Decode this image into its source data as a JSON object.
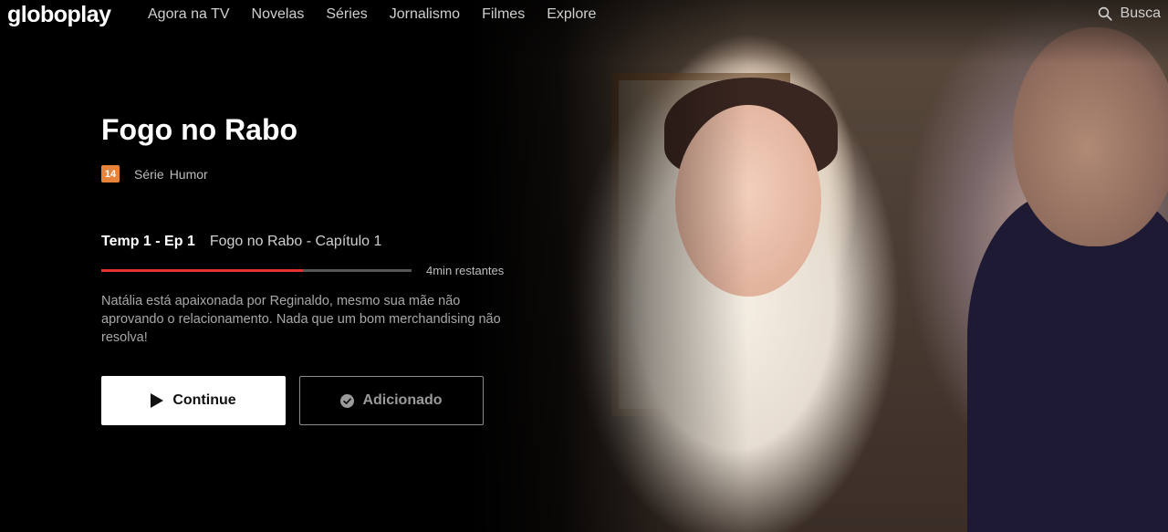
{
  "header": {
    "logo": "globoplay",
    "nav": [
      "Agora na TV",
      "Novelas",
      "Séries",
      "Jornalismo",
      "Filmes",
      "Explore"
    ],
    "search_label": "Busca",
    "search_icon": "search-icon"
  },
  "show": {
    "title": "Fogo no Rabo",
    "rating": "14",
    "rating_color": "#e8833a",
    "tags": [
      "Série",
      "Humor"
    ],
    "episode_number": "Temp 1 - Ep 1",
    "episode_title": "Fogo no Rabo - Capítulo 1",
    "progress_fraction": 0.65,
    "progress_color": "#e5322d",
    "remaining": "4min restantes",
    "description": "Natália está apaixonada por Reginaldo, mesmo sua mãe não aprovando o relacionamento. Nada que um bom merchandising não resolva!"
  },
  "actions": {
    "continue_label": "Continue",
    "continue_icon": "play-icon",
    "added_label": "Adicionado",
    "added_icon": "check-circle-icon"
  }
}
